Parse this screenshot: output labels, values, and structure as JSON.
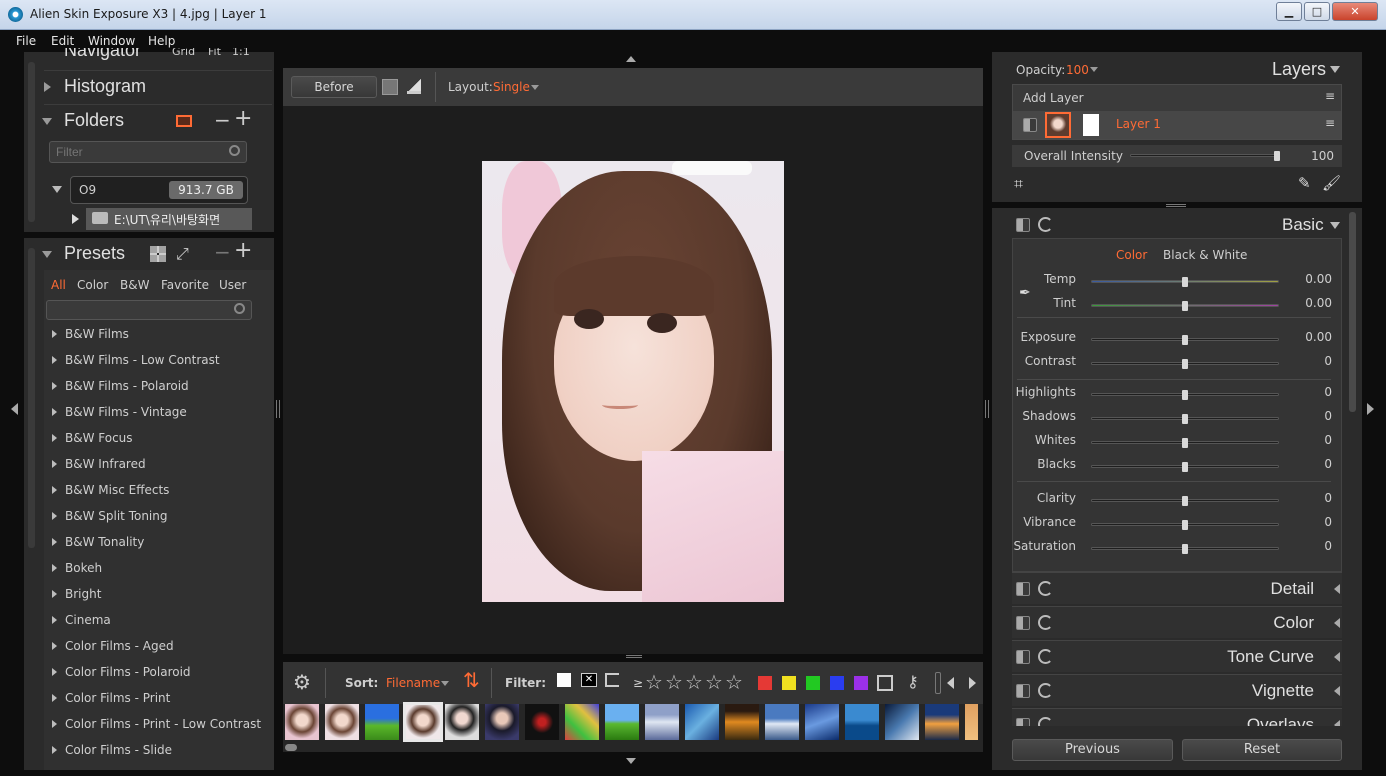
{
  "window": {
    "title": "Alien Skin Exposure X3 | 4.jpg | Layer 1",
    "min": "▁",
    "max": "□",
    "close": "✕"
  },
  "menu": [
    "File",
    "Edit",
    "Window",
    "Help"
  ],
  "left": {
    "navigator": {
      "label": "Navigator",
      "opts": [
        "Grid",
        "Fit",
        "1:1"
      ]
    },
    "histogram": {
      "label": "Histogram"
    },
    "folders": {
      "label": "Folders",
      "filter_placeholder": "Filter",
      "drive": "O9",
      "size": "913.7 GB",
      "path": "E:\\UT\\유리\\바탕화면"
    },
    "presets": {
      "label": "Presets",
      "tabs": [
        "All",
        "Color",
        "B&W",
        "Favorite",
        "User"
      ],
      "items": [
        "B&W Films",
        "B&W Films - Low Contrast",
        "B&W Films - Polaroid",
        "B&W Films - Vintage",
        "B&W Focus",
        "B&W Infrared",
        "B&W Misc Effects",
        "B&W Split Toning",
        "B&W Tonality",
        "Bokeh",
        "Bright",
        "Cinema",
        "Color Films - Aged",
        "Color Films - Polaroid",
        "Color Films - Print",
        "Color Films - Print - Low Contrast",
        "Color Films - Slide"
      ]
    }
  },
  "center": {
    "before": "Before",
    "layout_label": "Layout:",
    "layout_value": "Single",
    "filmbar": {
      "sort_label": "Sort:",
      "sort_value": "Filename",
      "filter_label": "Filter:",
      "ge": "≥",
      "stars": [
        "☆",
        "☆",
        "☆",
        "☆",
        "☆"
      ]
    }
  },
  "right": {
    "opacity_label": "Opacity:",
    "opacity_value": "100",
    "layers_label": "Layers",
    "add_layer": "Add Layer",
    "layer_name": "Layer 1",
    "overall_label": "Overall Intensity",
    "overall_value": "100",
    "overall_level": 0.98,
    "basic": {
      "label": "Basic",
      "mode_color": "Color",
      "mode_bw": "Black & White",
      "sliders": [
        {
          "label": "Temp",
          "value": "0.00"
        },
        {
          "label": "Tint",
          "value": "0.00"
        },
        {
          "label": "Exposure",
          "value": "0.00"
        },
        {
          "label": "Contrast",
          "value": "0"
        },
        {
          "label": "Highlights",
          "value": "0"
        },
        {
          "label": "Shadows",
          "value": "0"
        },
        {
          "label": "Whites",
          "value": "0"
        },
        {
          "label": "Blacks",
          "value": "0"
        },
        {
          "label": "Clarity",
          "value": "0"
        },
        {
          "label": "Vibrance",
          "value": "0"
        },
        {
          "label": "Saturation",
          "value": "0"
        }
      ]
    },
    "sections": [
      "Detail",
      "Color",
      "Tone Curve",
      "Vignette",
      "Overlays"
    ],
    "previous": "Previous",
    "reset": "Reset"
  },
  "colors": {
    "accent": "#ff6b35",
    "labels": [
      "#e53935",
      "#f0e020",
      "#22c922",
      "#2a3df0",
      "#9b30e8"
    ]
  }
}
